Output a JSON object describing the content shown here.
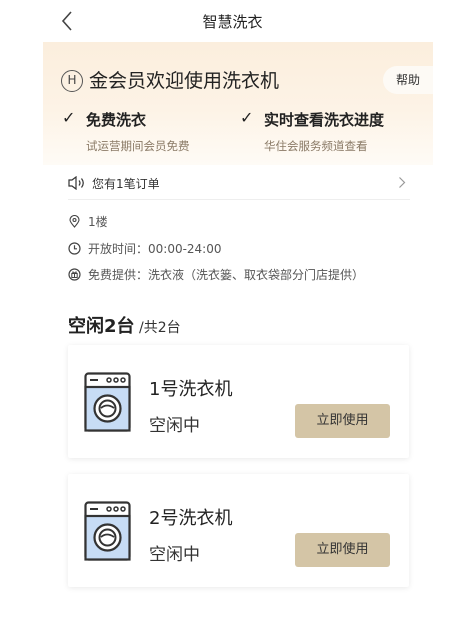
{
  "nav": {
    "title": "智慧洗衣"
  },
  "banner": {
    "logo_letter": "H",
    "headline": "金会员欢迎使用洗衣机",
    "help_label": "帮助",
    "features": [
      {
        "check": "✓",
        "title": "免费洗衣",
        "subtitle": "试运营期间会员免费"
      },
      {
        "check": "✓",
        "title": "实时查看洗衣进度",
        "subtitle": "华住会服务频道查看"
      }
    ]
  },
  "order": {
    "text": "您有1笔订单"
  },
  "info": {
    "location": "1楼",
    "hours": "开放时间：00:00-24:00",
    "free_supply": "免费提供：洗衣液（洗衣篓、取衣袋部分门店提供）"
  },
  "summary": {
    "idle": "空闲2台",
    "total": " /共2台"
  },
  "machines": [
    {
      "name": "1号洗衣机",
      "status": "空闲中",
      "button": "立即使用"
    },
    {
      "name": "2号洗衣机",
      "status": "空闲中",
      "button": "立即使用"
    }
  ],
  "icons": {
    "back": "chevron-left-icon",
    "speaker": "speaker-icon",
    "location": "location-pin-icon",
    "clock": "clock-icon",
    "gift": "gift-icon",
    "washer": "washing-machine-icon"
  },
  "colors": {
    "accent_button": "#d4c5a6",
    "banner_bg": "#fbeedd",
    "subtitle": "#8a7a66"
  }
}
